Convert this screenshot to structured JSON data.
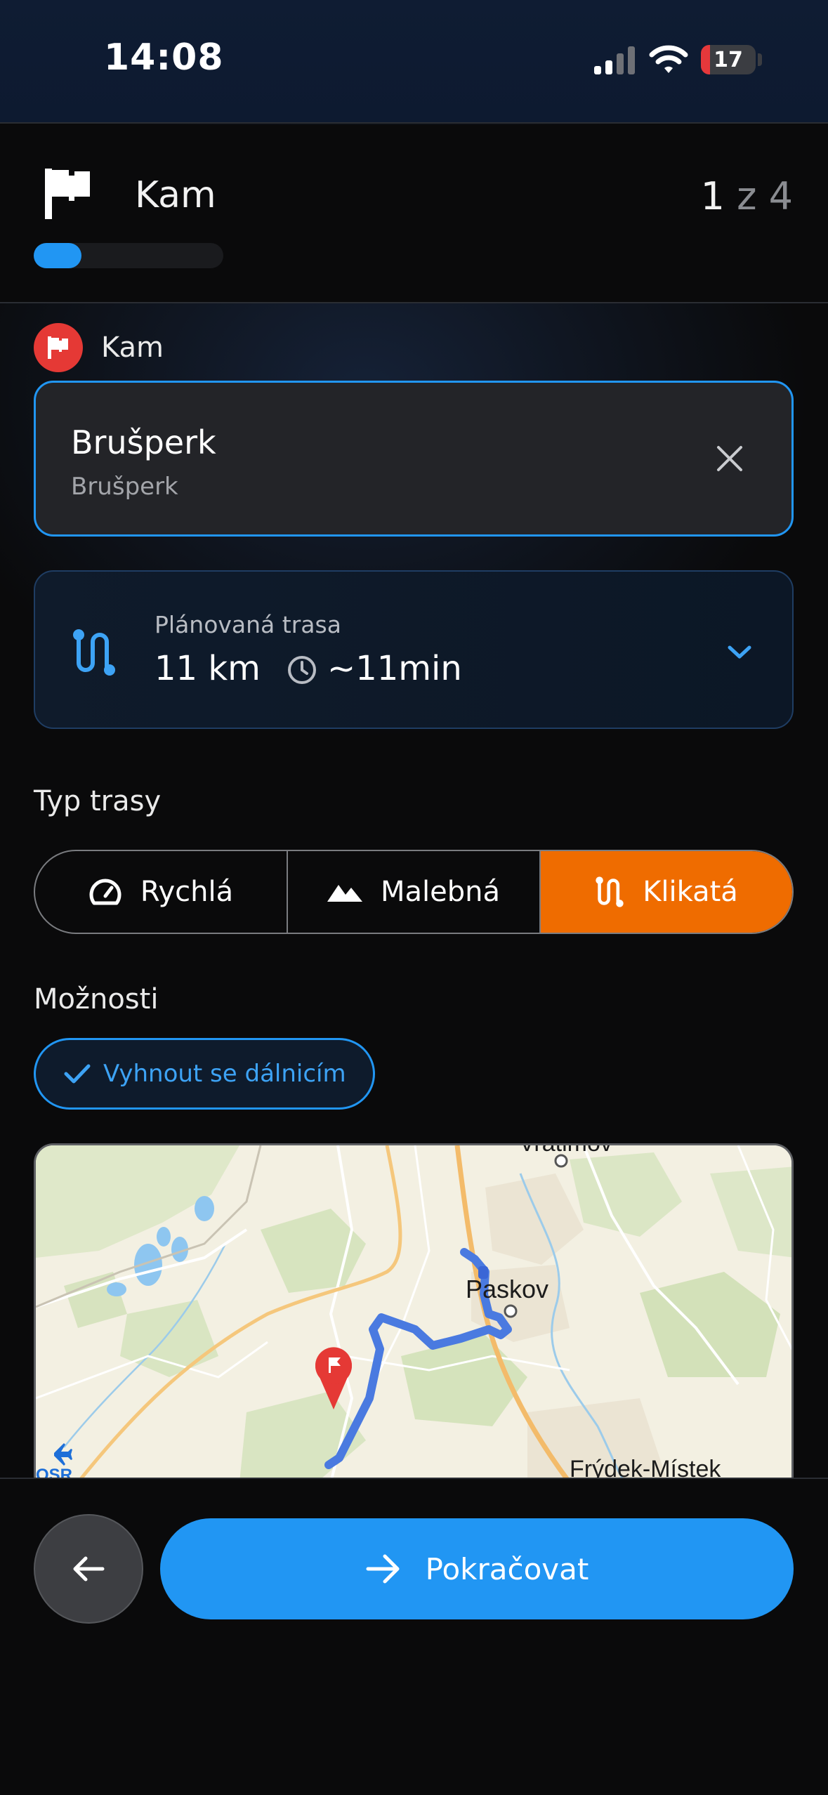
{
  "status_bar": {
    "time": "14:08",
    "battery_level": "17",
    "battery_fraction": 0.17,
    "icons": [
      "signal-icon",
      "wifi-icon",
      "battery-icon"
    ]
  },
  "step": {
    "title": "Kam",
    "current": "1",
    "of_total": " z 4",
    "progress_fraction": 0.25,
    "icon": "flag-icon"
  },
  "destination": {
    "label": "Kam",
    "name": "Brušperk",
    "subtitle": "Brušperk",
    "icons": [
      "flag-badge-icon",
      "close-icon"
    ]
  },
  "route": {
    "caption": "Plánovaná trasa",
    "distance": "11 km",
    "duration": "~11min",
    "icons": [
      "route-icon",
      "clock-icon",
      "chevron-down-icon"
    ]
  },
  "route_type": {
    "label": "Typ trasy",
    "options": [
      {
        "label": "Rychlá",
        "icon": "speedometer-icon",
        "active": false
      },
      {
        "label": "Malebná",
        "icon": "mountain-icon",
        "active": false
      },
      {
        "label": "Klikatá",
        "icon": "route-icon",
        "active": true
      }
    ]
  },
  "options": {
    "label": "Možnosti",
    "chips": [
      {
        "label": "Vyhnout se dálnicím",
        "selected": true,
        "icon": "check-icon"
      }
    ]
  },
  "map": {
    "labels": {
      "vratimov": "Vratimov",
      "paskov": "Paskov",
      "frydek": "Frýdek-Místek",
      "osp": "OSR"
    },
    "icons": [
      "destination-pin-icon",
      "airport-icon"
    ]
  },
  "footer": {
    "continue_label": "Pokračovat",
    "icons": [
      "arrow-left-icon",
      "arrow-right-icon"
    ]
  },
  "colors": {
    "accent_blue": "#2196f3",
    "accent_orange": "#ef6c00",
    "destination_red": "#e53935",
    "route_line": "#4a7ae0"
  }
}
